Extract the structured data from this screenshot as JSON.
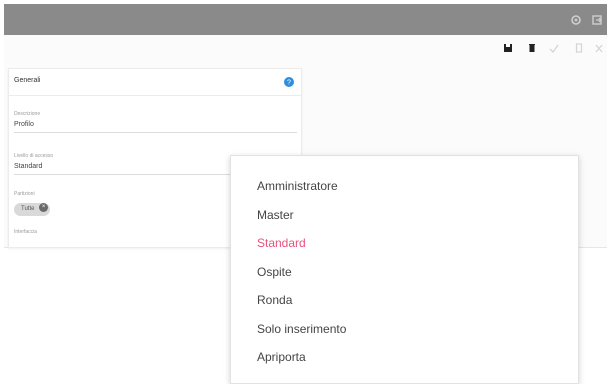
{
  "colors": {
    "topbar": "#8a8a8a",
    "selected_option": "#e8527d",
    "help_icon": "#2d8fe0",
    "chip_bg": "#d9d9d9"
  },
  "topbar": {
    "icons": [
      "settings-icon",
      "exit-icon"
    ]
  },
  "toolbar": {
    "icons": [
      "save-icon",
      "delete-icon",
      "check-icon",
      "copy-icon",
      "close-icon"
    ]
  },
  "card": {
    "title": "Generali",
    "fields": [
      {
        "label": "Descrizione",
        "value": "Profilo"
      },
      {
        "label": "Livello di accesso",
        "value": "Standard"
      },
      {
        "label": "Partizioni",
        "chip": "Tutte"
      },
      {
        "label": "Interfaccia"
      }
    ]
  },
  "dropdown": {
    "options": [
      "Amministratore",
      "Master",
      "Standard",
      "Ospite",
      "Ronda",
      "Solo inserimento",
      "Apriporta"
    ],
    "selected": "Standard"
  }
}
